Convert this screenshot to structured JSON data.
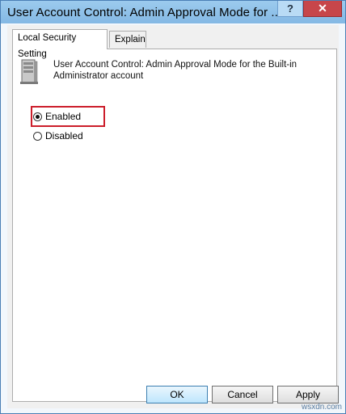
{
  "window": {
    "title": "User Account Control: Admin Approval Mode for ...",
    "help_label": "?",
    "close_label": "✕"
  },
  "tabs": [
    {
      "label": "Local Security Setting",
      "active": true
    },
    {
      "label": "Explain",
      "active": false
    }
  ],
  "policy": {
    "icon": "server-policy-icon",
    "title": "User Account Control: Admin Approval Mode for the Built-in Administrator account"
  },
  "options": [
    {
      "label": "Enabled",
      "checked": true
    },
    {
      "label": "Disabled",
      "checked": false
    }
  ],
  "buttons": {
    "ok": "OK",
    "cancel": "Cancel",
    "apply": "Apply"
  },
  "watermark": "wsxdn.com",
  "colors": {
    "highlight": "#cc1e2b",
    "title_bar": "#8ec1e8",
    "close_button": "#c7464a"
  }
}
